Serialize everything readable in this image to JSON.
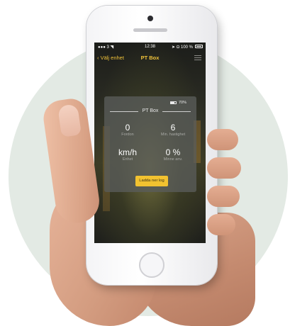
{
  "statusbar": {
    "carrier": "●●● 3 ◥",
    "time": "12:38",
    "right": "➤ Ω 100 %"
  },
  "navbar": {
    "back_label": "‹ Välj enhet",
    "title": "PT Box",
    "menu_icon": "hamburger-icon"
  },
  "card": {
    "battery": "70%",
    "title": "PT Box",
    "stats": [
      {
        "value": "0",
        "label": "Fordon"
      },
      {
        "value": "6",
        "label": "Min. hastighet"
      },
      {
        "value": "km/h",
        "label": "Enhet"
      },
      {
        "value": "0 %",
        "label": "Minne anv."
      }
    ],
    "button_label": "Ladda ner log"
  },
  "colors": {
    "accent": "#f2c230",
    "nav_text": "#f0c23a",
    "circle_bg": "#e3eae4"
  }
}
